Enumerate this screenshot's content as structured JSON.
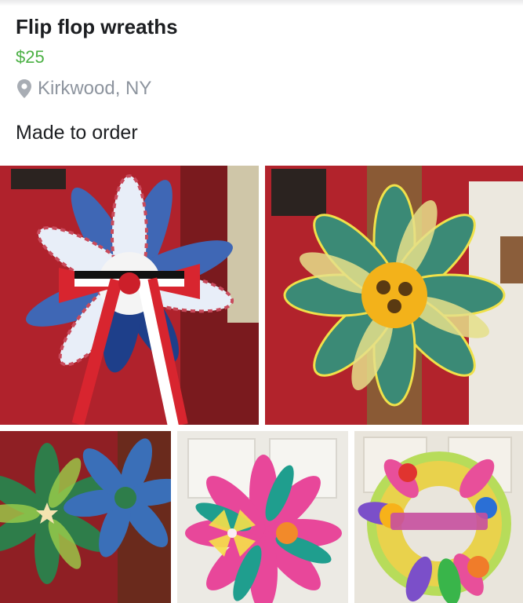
{
  "listing": {
    "title": "Flip flop wreaths",
    "price": "$25",
    "location": "Kirkwood, NY",
    "description": "Made to order",
    "price_color": "#4bb044"
  },
  "icons": {
    "location": "location-pin-icon"
  },
  "photos": [
    {
      "subject": "red white and blue flip flop wreath with striped bow"
    },
    {
      "subject": "floral flip flop wreath with sunflower center"
    },
    {
      "subject": "beach flip flop wreaths with starfish"
    },
    {
      "subject": "pink and teal flip flop wreath with pinwheel"
    },
    {
      "subject": "bright flip flop wreath with welcome sign"
    }
  ]
}
